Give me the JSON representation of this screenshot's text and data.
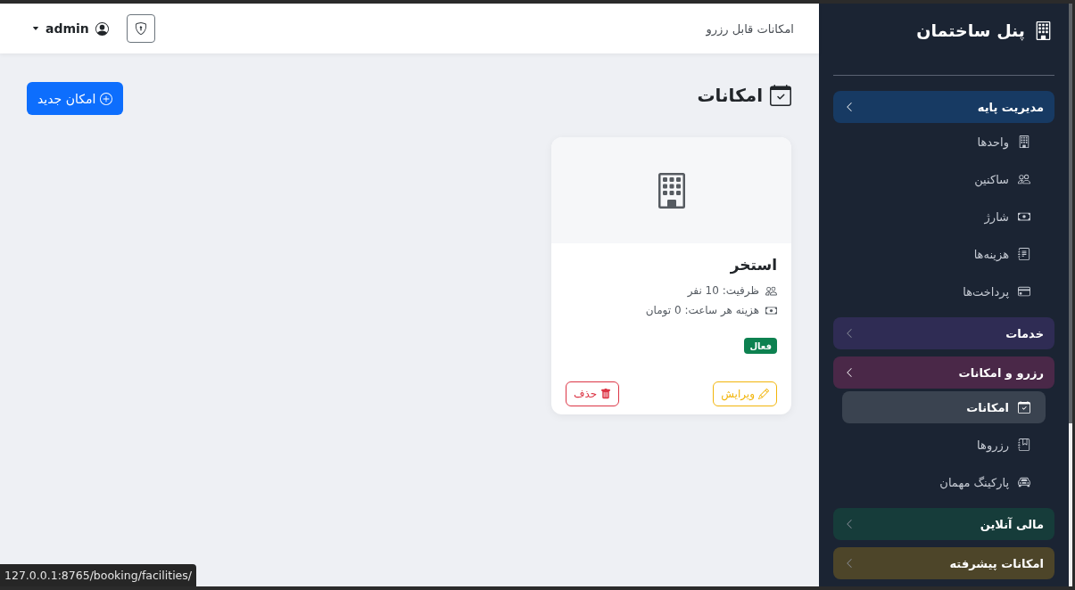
{
  "header": {
    "title": "امکانات قابل رزرو",
    "user": "admin"
  },
  "page": {
    "title": "امکانات",
    "new_button": "امکان جدید"
  },
  "cards": [
    {
      "title": "استخر",
      "details": [
        {
          "kind": "capacity",
          "text": "ظرفیت: 10 نفر"
        },
        {
          "kind": "hourly_cost",
          "text": "هزینه هر ساعت: 0 تومان"
        }
      ],
      "status": {
        "label": "فعال",
        "active": true
      },
      "edit_button": "ویرایش",
      "delete_button": "حذف"
    }
  ],
  "sidebar": {
    "title": "پنل ساختمان",
    "groups": [
      {
        "label": "مدیریت پایه",
        "color": "#173a63",
        "expanded": true,
        "items": [
          {
            "kind": "units",
            "label": "واحدها",
            "selected": false
          },
          {
            "kind": "residents",
            "label": "ساکنین",
            "selected": false
          },
          {
            "kind": "charge",
            "label": "شارژ",
            "selected": false
          },
          {
            "kind": "expenses",
            "label": "هزینه‌ها",
            "selected": false
          },
          {
            "kind": "payments",
            "label": "پرداخت‌ها",
            "selected": false
          }
        ]
      },
      {
        "label": "خدمات",
        "color": "#2f2c54",
        "expanded": false
      },
      {
        "label": "رزرو و امکانات",
        "color": "#4a2848",
        "expanded": true,
        "items": [
          {
            "kind": "facilities",
            "label": "امکانات",
            "selected": true
          },
          {
            "kind": "reservations",
            "label": "رزروها",
            "selected": false
          },
          {
            "kind": "parking",
            "label": "پارکینگ مهمان",
            "selected": false
          }
        ]
      },
      {
        "label": "مالی آنلاین",
        "color": "#163c3a",
        "expanded": false
      },
      {
        "label": "امکانات پیشرفته",
        "color": "#4d4529",
        "expanded": false
      }
    ]
  },
  "status_url": "127.0.0.1:8765/booking/facilities/"
}
